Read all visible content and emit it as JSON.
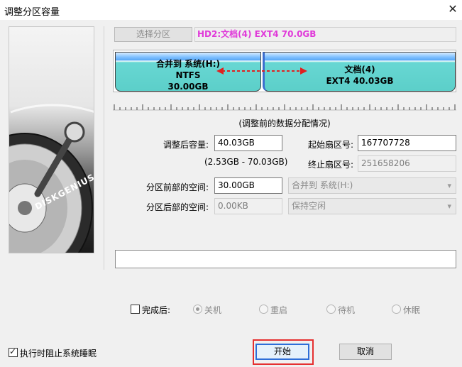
{
  "window": {
    "title": "调整分区容量",
    "close_glyph": "✕"
  },
  "side_panel": {
    "logo_text": "DISKGENIUS"
  },
  "map": {
    "select_button": "选择分区",
    "disk_label": "HD2:文档(4) EXT4 70.0GB",
    "partition_left": {
      "line1": "合并到 系统(H:)",
      "line2": "NTFS",
      "line3": "30.00GB"
    },
    "partition_right": {
      "line1": "文档(4)",
      "line2": "EXT4 40.03GB"
    },
    "caption": "(调整前的数据分配情况)"
  },
  "form": {
    "size_label": "调整后容量:",
    "size_value": "40.03GB",
    "size_range": "(2.53GB - 70.03GB)",
    "start_sector_label": "起始扇区号:",
    "start_sector_value": "167707728",
    "end_sector_label": "终止扇区号:",
    "end_sector_value": "251658206",
    "before_space_label": "分区前部的空间:",
    "before_space_value": "30.00GB",
    "before_space_action": "合并到 系统(H:)",
    "after_space_label": "分区后部的空间:",
    "after_space_value": "0.00KB",
    "after_space_action": "保持空闲"
  },
  "completion": {
    "label": "完成后:",
    "checked": false,
    "options": [
      "关机",
      "重启",
      "待机",
      "休眠"
    ],
    "selected_index": 0
  },
  "footer": {
    "prevent_sleep_label": "执行时阻止系统睡眠",
    "prevent_sleep_checked": true,
    "start_button": "开始",
    "cancel_button": "取消"
  },
  "colors": {
    "disk_label_text": "#e03ad9",
    "arrow": "#e02020",
    "highlight_border": "#e53030",
    "primary_border": "#2d6ed8"
  }
}
